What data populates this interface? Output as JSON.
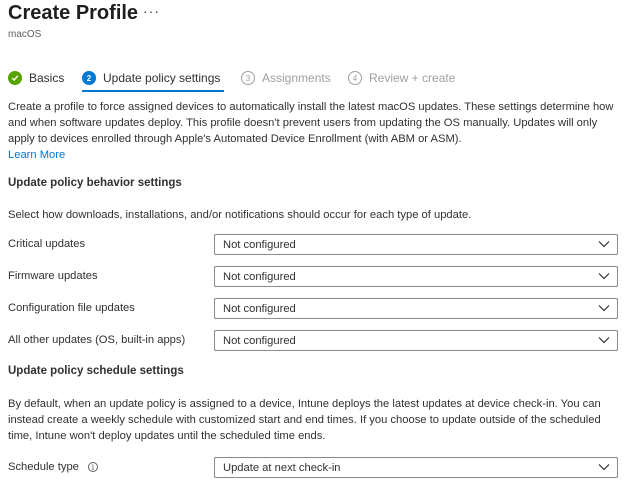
{
  "header": {
    "title": "Create Profile",
    "more_label": "···",
    "subtitle": "macOS"
  },
  "wizard": {
    "steps": [
      {
        "number": "",
        "label": "Basics",
        "state": "done"
      },
      {
        "number": "2",
        "label": "Update policy settings",
        "state": "active"
      },
      {
        "number": "3",
        "label": "Assignments",
        "state": "todo"
      },
      {
        "number": "4",
        "label": "Review + create",
        "state": "todo"
      }
    ]
  },
  "intro": {
    "text": "Create a profile to force assigned devices to automatically install the latest macOS updates. These settings determine how and when software updates deploy. This profile doesn't prevent users from updating the OS manually. Updates will only apply to devices enrolled through Apple's Automated Device Enrollment (with ABM or ASM).",
    "link": "Learn More"
  },
  "behavior": {
    "heading": "Update policy behavior settings",
    "description": "Select how downloads, installations, and/or notifications should occur for each type of update.",
    "rows": [
      {
        "label": "Critical updates",
        "value": "Not configured"
      },
      {
        "label": "Firmware updates",
        "value": "Not configured"
      },
      {
        "label": "Configuration file updates",
        "value": "Not configured"
      },
      {
        "label": "All other updates (OS, built-in apps)",
        "value": "Not configured"
      }
    ]
  },
  "schedule": {
    "heading": "Update policy schedule settings",
    "description": "By default, when an update policy is assigned to a device, Intune deploys the latest updates at device check-in. You can instead create a weekly schedule with customized start and end times. If you choose to update outside of the scheduled time, Intune won't deploy updates until the scheduled time ends.",
    "type_label": "Schedule type",
    "type_value": "Update at next check-in"
  },
  "colors": {
    "accent": "#0078d4",
    "success": "#57a300",
    "text": "#323130",
    "muted": "#a19f9d"
  }
}
